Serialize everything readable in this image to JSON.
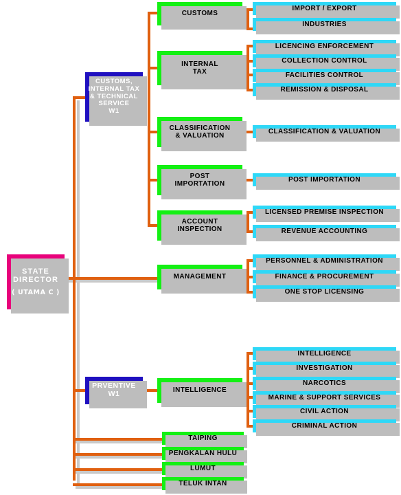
{
  "chart_data": {
    "type": "diagram",
    "title": "State Customs Department Organisation Chart",
    "colors": {
      "root": "#E8027B",
      "division": "#1F10C0",
      "unit": "#14F014",
      "leaf": "#2ED8F7",
      "connector": "#E06010",
      "shadow": "#bdbdbd",
      "background": "#FFFFFF"
    },
    "root": {
      "label": "STATE DIRECTOR",
      "line1": "STATE",
      "line2": "DIRECTOR",
      "sub": "( UTAMA C )"
    },
    "divisions": [
      {
        "id": "customs-internal-tax-technical-service",
        "lines": [
          "CUSTOMS,",
          "INTERNAL TAX",
          "& TECHNICAL",
          "SERVICE",
          "W1"
        ],
        "units": [
          {
            "label": "CUSTOMS",
            "lines": [
              "CUSTOMS"
            ],
            "leaves": [
              "IMPORT / EXPORT",
              "INDUSTRIES"
            ]
          },
          {
            "label": "INTERNAL TAX",
            "lines": [
              "INTERNAL",
              "TAX"
            ],
            "leaves": [
              "LICENCING ENFORCEMENT",
              "COLLECTION CONTROL",
              "FACILITIES CONTROL",
              "REMISSION & DISPOSAL"
            ]
          },
          {
            "label": "CLASSIFICATION & VALUATION",
            "lines": [
              "CLASSIFICATION",
              "& VALUATION"
            ],
            "leaves": [
              "CLASSIFICATION & VALUATION"
            ]
          },
          {
            "label": "POST IMPORTATION",
            "lines": [
              "POST",
              "IMPORTATION"
            ],
            "leaves": [
              "POST IMPORTATION"
            ]
          },
          {
            "label": "ACCOUNT INSPECTION",
            "lines": [
              "ACCOUNT",
              "INSPECTION"
            ],
            "leaves": [
              "LICENSED PREMISE INSPECTION",
              "REVENUE ACCOUNTING"
            ]
          }
        ]
      },
      {
        "id": "prventive",
        "lines": [
          "PRVENTIVE",
          "W1"
        ],
        "units": [
          {
            "label": "INTELLIGENCE",
            "lines": [
              "INTELLIGENCE"
            ],
            "leaves": [
              "INTELLIGENCE",
              "INVESTIGATION",
              "NARCOTICS",
              "MARINE & SUPPORT SERVICES",
              "CIVIL ACTION",
              "CRIMINAL ACTION"
            ]
          }
        ]
      }
    ],
    "management": {
      "label": "MANAGEMENT",
      "lines": [
        "MANAGEMENT"
      ],
      "leaves": [
        "PERSONNEL & ADMINISTRATION",
        "FINANCE & PROCUREMENT",
        "ONE STOP LICENSING"
      ]
    },
    "stations": [
      "TAIPING",
      "PENGKALAN HULU",
      "LUMUT",
      "TELUK INTAN"
    ]
  }
}
